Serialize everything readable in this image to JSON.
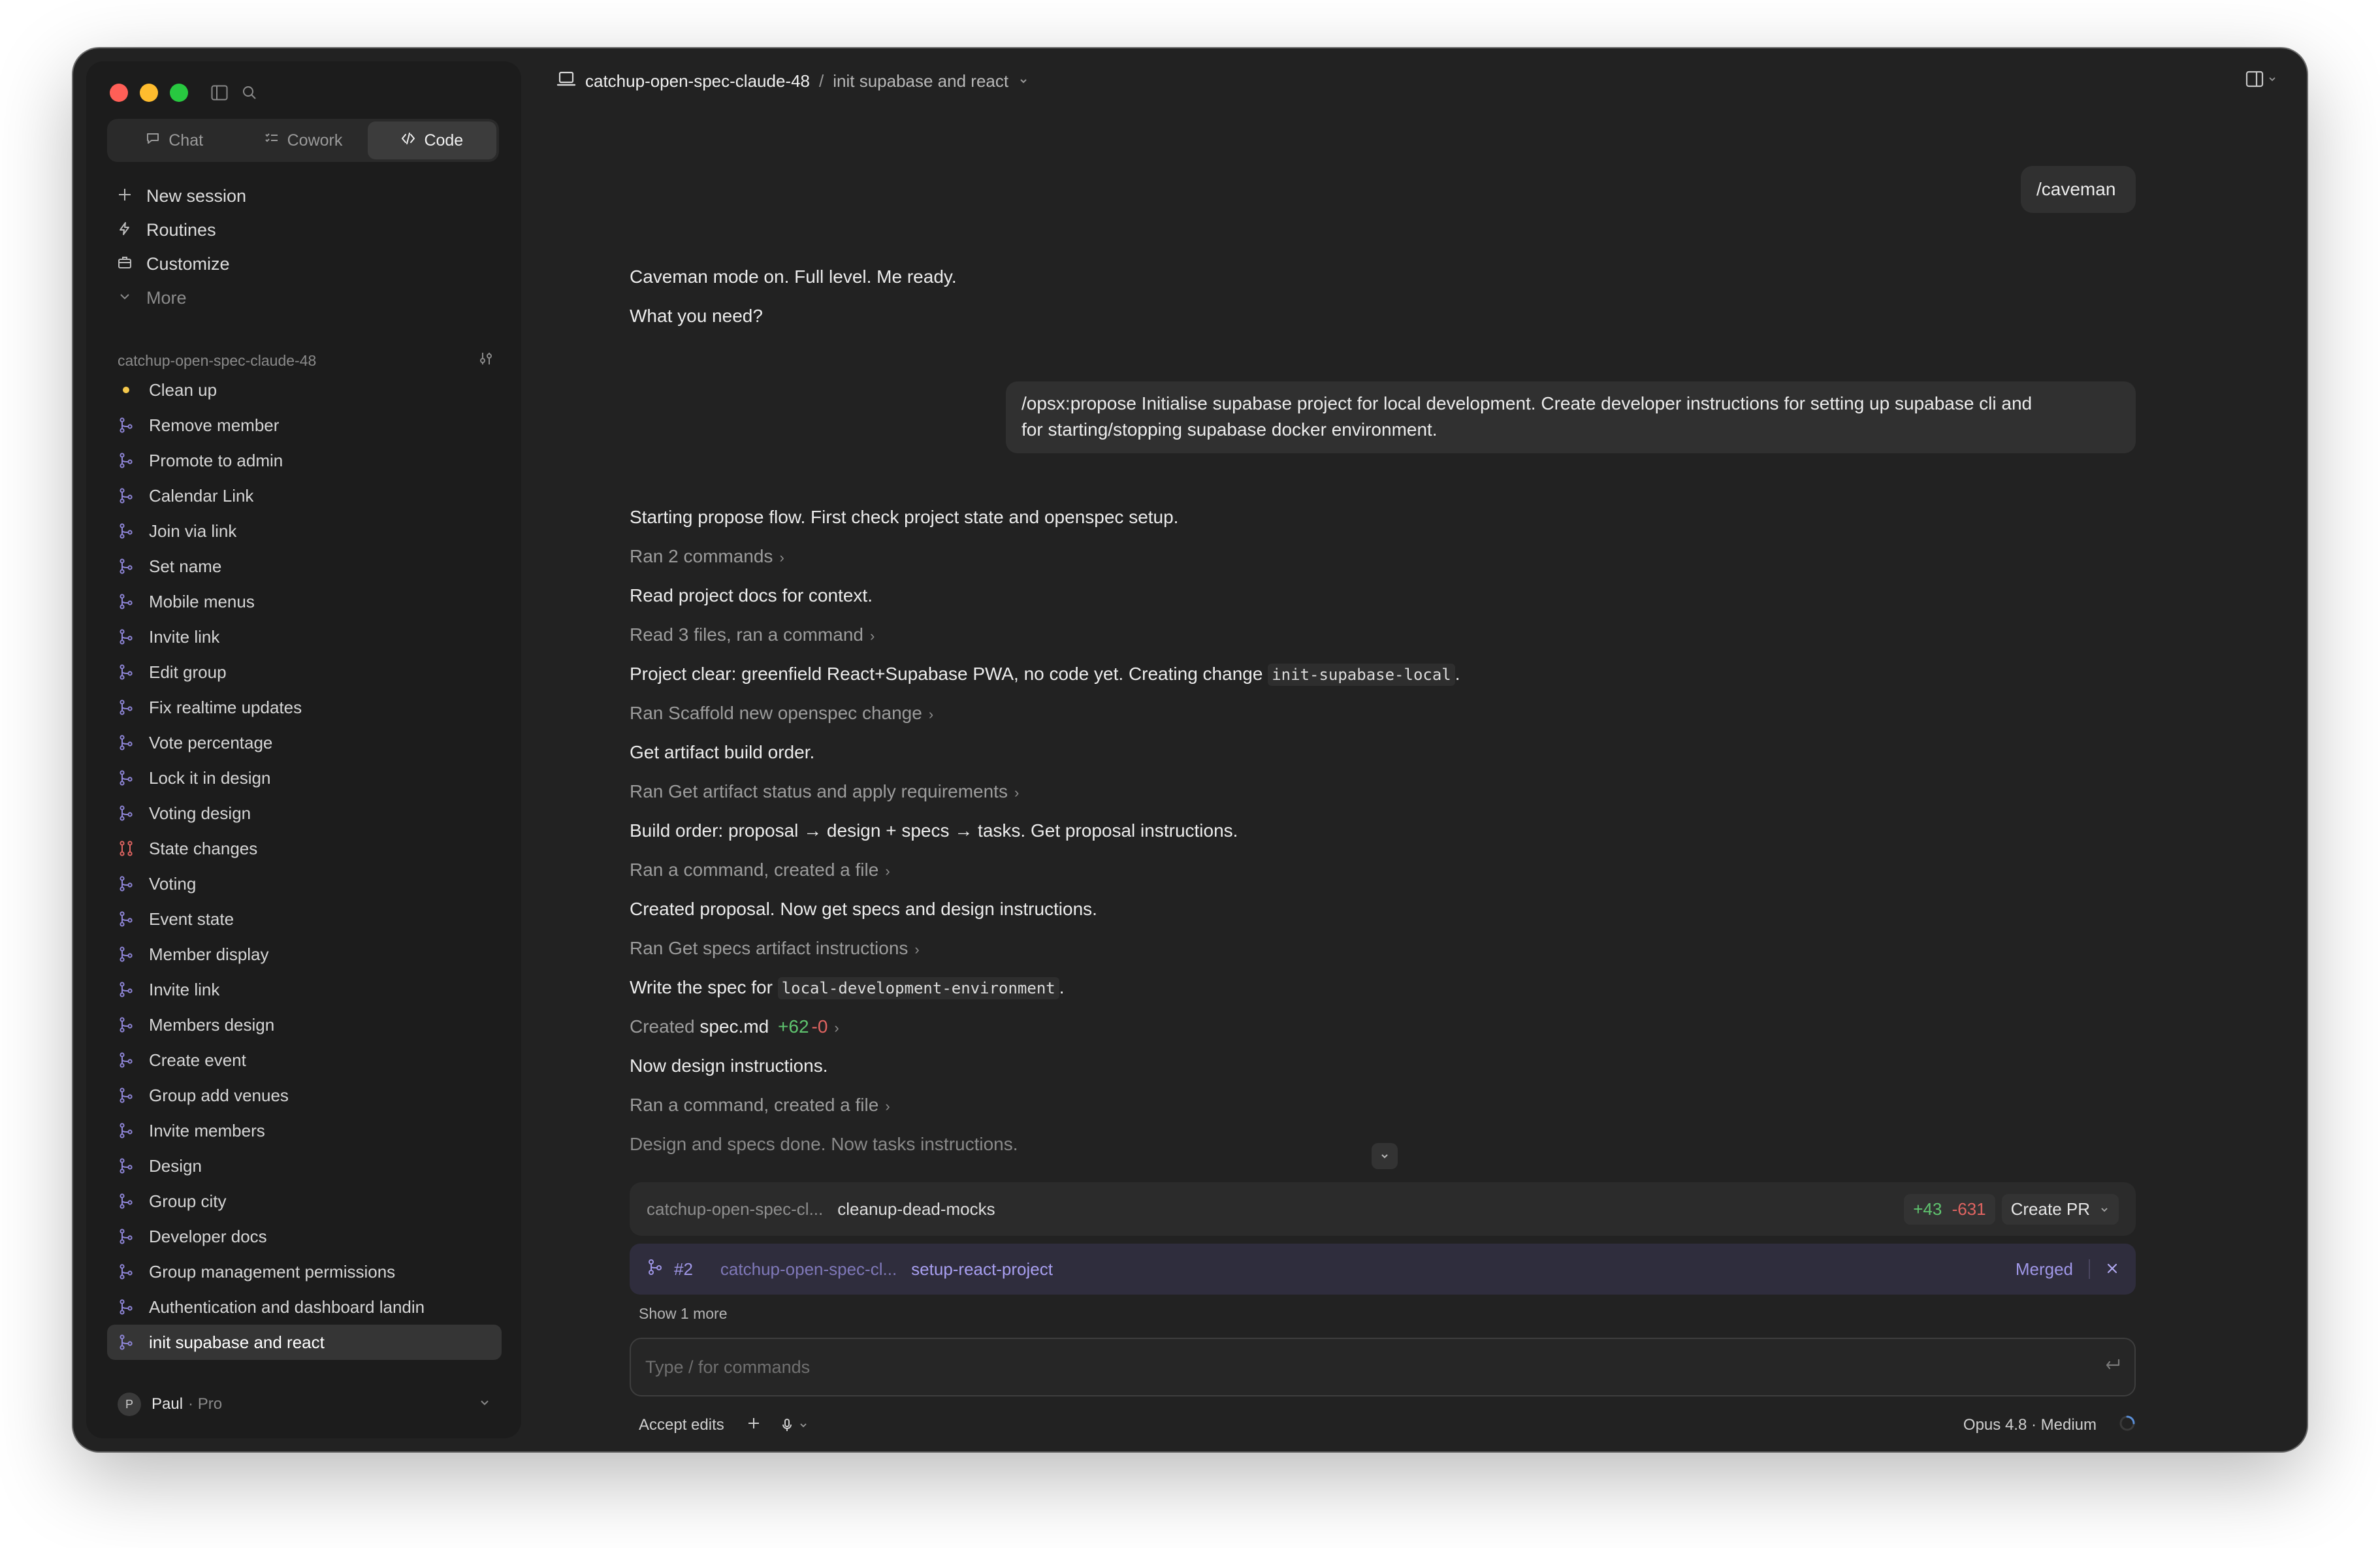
{
  "sidebar": {
    "tabs": [
      {
        "label": "Chat",
        "icon": "chat-bubble-icon"
      },
      {
        "label": "Cowork",
        "icon": "checklist-icon"
      },
      {
        "label": "Code",
        "icon": "code-brackets-icon"
      }
    ],
    "nav": [
      {
        "label": "New session",
        "icon": "plus-icon"
      },
      {
        "label": "Routines",
        "icon": "lightning-icon"
      },
      {
        "label": "Customize",
        "icon": "briefcase-icon"
      },
      {
        "label": "More",
        "icon": "chevron-down-icon"
      }
    ],
    "project": "catchup-open-spec-claude-48",
    "sessions": [
      {
        "label": "Clean up",
        "icon": "dot"
      },
      {
        "label": "Remove member",
        "icon": "branch"
      },
      {
        "label": "Promote to admin",
        "icon": "branch"
      },
      {
        "label": "Calendar Link",
        "icon": "branch"
      },
      {
        "label": "Join via link",
        "icon": "branch"
      },
      {
        "label": "Set name",
        "icon": "branch"
      },
      {
        "label": "Mobile menus",
        "icon": "branch"
      },
      {
        "label": "Invite link",
        "icon": "branch"
      },
      {
        "label": "Edit group",
        "icon": "branch"
      },
      {
        "label": "Fix realtime updates",
        "icon": "branch"
      },
      {
        "label": "Vote percentage",
        "icon": "branch"
      },
      {
        "label": "Lock it in design",
        "icon": "branch"
      },
      {
        "label": "Voting design",
        "icon": "branch"
      },
      {
        "label": "State changes",
        "icon": "conflict"
      },
      {
        "label": "Voting",
        "icon": "branch"
      },
      {
        "label": "Event state",
        "icon": "branch"
      },
      {
        "label": "Member display",
        "icon": "branch"
      },
      {
        "label": "Invite link",
        "icon": "branch"
      },
      {
        "label": "Members design",
        "icon": "branch"
      },
      {
        "label": "Create event",
        "icon": "branch"
      },
      {
        "label": "Group add venues",
        "icon": "branch"
      },
      {
        "label": "Invite members",
        "icon": "branch"
      },
      {
        "label": "Design",
        "icon": "branch"
      },
      {
        "label": "Group city",
        "icon": "branch"
      },
      {
        "label": "Developer docs",
        "icon": "branch"
      },
      {
        "label": "Group management permissions",
        "icon": "branch"
      },
      {
        "label": "Authentication and dashboard landin",
        "icon": "branch"
      },
      {
        "label": "init supabase and react",
        "icon": "branch",
        "active": true
      }
    ],
    "user": {
      "name": "Paul",
      "plan": "· Pro",
      "initial": "P"
    }
  },
  "header": {
    "project": "catchup-open-spec-claude-48",
    "separator": "/",
    "session": "init supabase and react"
  },
  "conversation": {
    "user_msg_1": "/caveman",
    "reply_1_line1": "Caveman mode on. Full level. Me ready.",
    "reply_1_line2": "What you need?",
    "user_msg_2_line1": "/opsx:propose Initialise supabase project for local development. Create developer instructions for setting up supabase cli and",
    "user_msg_2_line2": "for starting/stopping supabase docker environment.",
    "steps": {
      "s1": "Starting propose flow. First check project state and openspec setup.",
      "t1": "Ran 2 commands",
      "s2": "Read project docs for context.",
      "t2": "Read 3 files, ran a command",
      "s3_pre": "Project clear: greenfield React+Supabase PWA, no code yet. Creating change ",
      "s3_code": "init-supabase-local",
      "s3_post": ".",
      "t3": "Ran Scaffold new openspec change",
      "s4": "Get artifact build order.",
      "t4": "Ran Get artifact status and apply requirements",
      "s5": "Build order: proposal → design + specs → tasks. Get proposal instructions.",
      "t5": "Ran a command, created a file",
      "s6": "Created proposal. Now get specs and design instructions.",
      "t6": "Ran Get specs artifact instructions",
      "s7_pre": "Write the spec for ",
      "s7_code": "local-development-environment",
      "s7_post": ".",
      "t7_pre": "Created ",
      "t7_file": "spec.md",
      "t7_add": "+62",
      "t7_del": "-0",
      "s8": "Now design instructions.",
      "t8": "Ran a command, created a file",
      "s9": "Design and specs done. Now tasks instructions."
    }
  },
  "branch_bar": {
    "repo": "catchup-open-spec-cl...",
    "branch": "cleanup-dead-mocks",
    "additions": "+43",
    "deletions": "-631",
    "create_pr": "Create PR"
  },
  "pr_bar": {
    "number": "#2",
    "repo": "catchup-open-spec-cl...",
    "branch": "setup-react-project",
    "status": "Merged"
  },
  "show_more": "Show 1 more",
  "input": {
    "placeholder": "Type / for commands"
  },
  "footer": {
    "accept": "Accept edits",
    "model": "Opus 4.8 · Medium"
  },
  "colors": {
    "accent_purple": "#9f96e6",
    "add_green": "#5fc46f",
    "del_red": "#e06461",
    "dot_yellow": "#f5c84b"
  }
}
